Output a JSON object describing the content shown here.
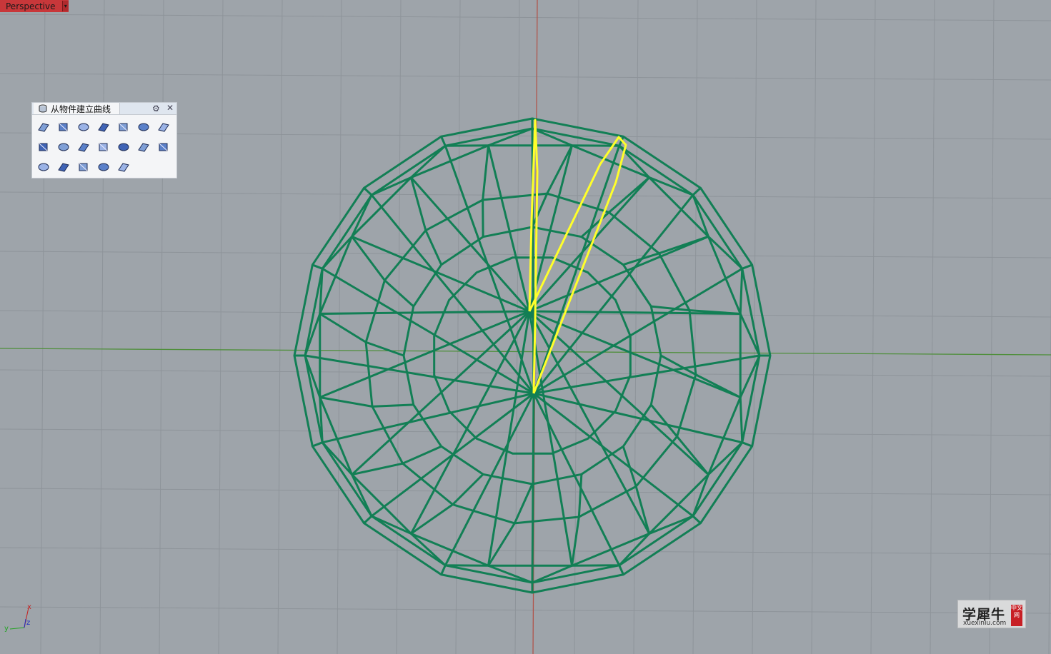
{
  "viewport": {
    "name": "Perspective",
    "menu_arrow": "▾"
  },
  "toolbar": {
    "title": "从物件建立曲线",
    "tab_icon": "curve-from-object-icon",
    "gear_icon": "gear-icon",
    "close_icon": "close-icon",
    "buttons": [
      "duplicate-edge-icon",
      "duplicate-border-icon",
      "create-uv-curves-icon",
      "project-curve-icon",
      "duplicate-face-border-icon",
      "pull-curve-icon",
      "extract-isocurve-icon",
      "extract-wireframe-icon",
      "silhouette-icon",
      "contour-icon",
      "section-icon",
      "intersection-icon",
      "curvature-graph-icon",
      "extract-points-icon",
      "point-cloud-icon",
      "object-properties-icon",
      "curve-network-icon",
      "mesh-outline-icon",
      "extract-render-mesh-icon"
    ]
  },
  "axes": {
    "x": "x",
    "y": "y",
    "z": "z"
  },
  "colors": {
    "background": "#9ea4aa",
    "grid": "#8e949a",
    "x_axis": "#4f8f3b",
    "y_axis": "#b0554c",
    "wireframe": "#127f55",
    "selection": "#ffff2a"
  },
  "watermark": {
    "cn": "学犀牛",
    "badge": "中文网",
    "en": "xuexiniu.com"
  }
}
